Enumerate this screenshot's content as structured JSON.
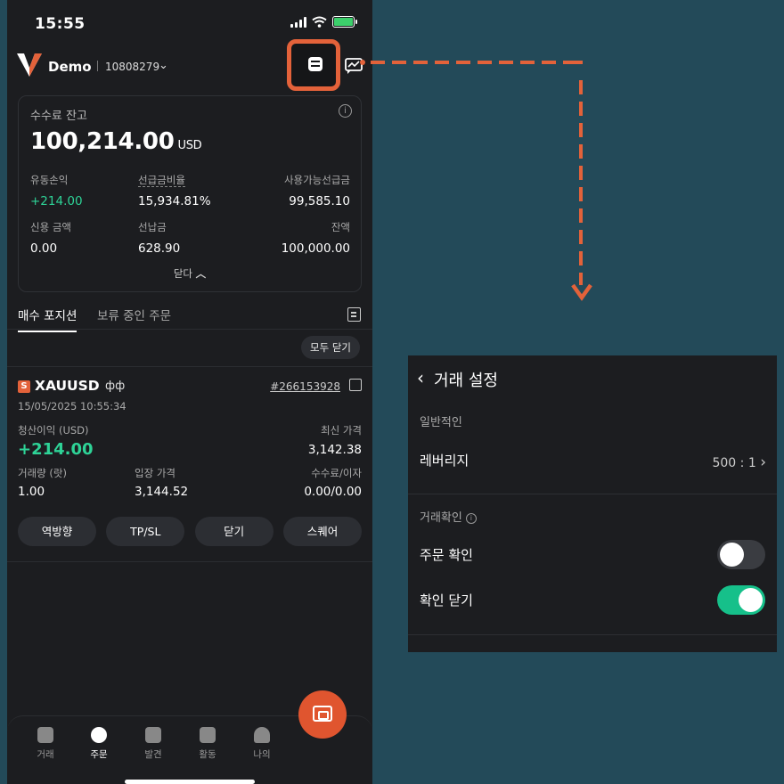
{
  "status": {
    "time": "15:55"
  },
  "header": {
    "account_name": "Demo",
    "account_id": "10808279"
  },
  "balance": {
    "label": "수수료 잔고",
    "value": "100,214.00",
    "unit": "USD",
    "floating_pl_label": "유동손익",
    "floating_pl_value": "+214.00",
    "margin_ratio_label": "선급금비율",
    "margin_ratio_value": "15,934.81%",
    "free_margin_label": "사용가능선급금",
    "free_margin_value": "99,585.10",
    "credit_label": "신용 금액",
    "credit_value": "0.00",
    "margin_label": "선납금",
    "margin_value": "628.90",
    "equity_label": "잔액",
    "equity_value": "100,000.00",
    "collapse_label": "닫다"
  },
  "tabs": [
    {
      "label": "매수 포지션"
    },
    {
      "label": "보류 중인 주문"
    }
  ],
  "close_all_label": "모두 닫기",
  "position": {
    "badge": "S",
    "symbol": "XAUUSD",
    "candle_glyph": "ф",
    "order_id": "#266153928",
    "open_time": "15/05/2025 10:55:34",
    "pl_label": "청산이익 (USD)",
    "pl_value": "+214.00",
    "latest_price_label": "최신 가격",
    "latest_price_value": "3,142.38",
    "volume_label": "거래량 (랏)",
    "volume_value": "1.00",
    "entry_price_label": "입장 가격",
    "entry_price_value": "3,144.52",
    "fee_label": "수수료/이자",
    "fee_value": "0.00/0.00",
    "actions": [
      {
        "label": "역방향"
      },
      {
        "label": "TP/SL"
      },
      {
        "label": "닫기"
      },
      {
        "label": "스퀘어"
      }
    ]
  },
  "nav": [
    {
      "label": "거래"
    },
    {
      "label": "주문"
    },
    {
      "label": "발견"
    },
    {
      "label": "활동"
    },
    {
      "label": "나의"
    }
  ],
  "settings_panel": {
    "title": "거래 설정",
    "general_section": "일반적인",
    "leverage_label": "레버리지",
    "leverage_value": "500 : 1",
    "confirm_section": "거래확인",
    "order_confirm_label": "주문 확인",
    "order_confirm_on": false,
    "close_confirm_label": "확인 닫기",
    "close_confirm_on": true
  },
  "colors": {
    "accent": "#e3623a",
    "profit": "#2ed397",
    "toggle_on": "#16c08a",
    "background": "#234a59"
  }
}
